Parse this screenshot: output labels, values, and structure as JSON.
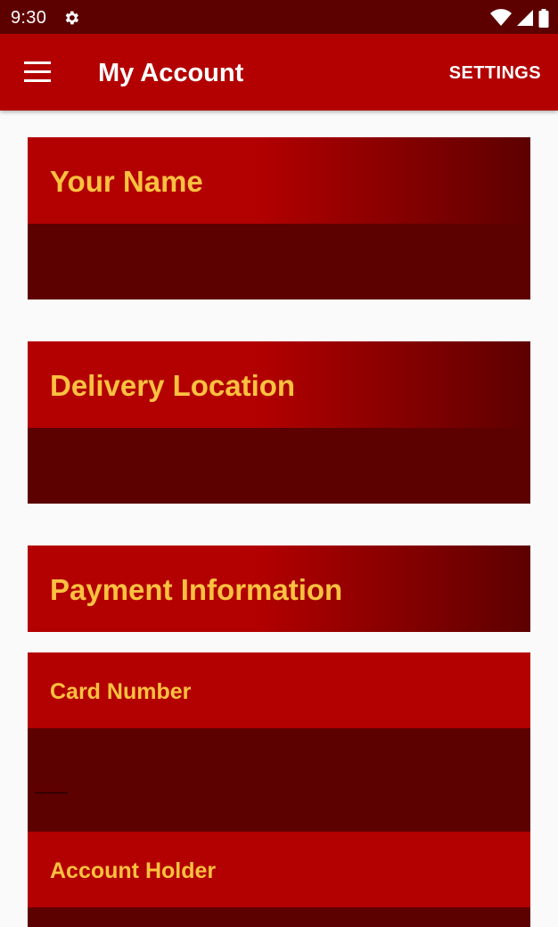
{
  "status_bar": {
    "time": "9:30",
    "icons": [
      "gear-icon",
      "wifi-icon",
      "signal-icon",
      "battery-icon"
    ]
  },
  "app_bar": {
    "title": "My Account",
    "menu_icon": "hamburger-menu-icon",
    "settings_label": "SETTINGS"
  },
  "sections": {
    "name": {
      "title": "Your Name",
      "value": ""
    },
    "delivery": {
      "title": "Delivery Location",
      "value": ""
    },
    "payment": {
      "title": "Payment Information"
    }
  },
  "payment_fields": {
    "card_number": {
      "label": "Card Number",
      "value": ""
    },
    "account_holder": {
      "label": "Account Holder",
      "value": ""
    }
  },
  "colors": {
    "primary": "#b30000",
    "primary_dark": "#5d0000",
    "accent_text": "#fbc140",
    "background": "#fafafa"
  }
}
